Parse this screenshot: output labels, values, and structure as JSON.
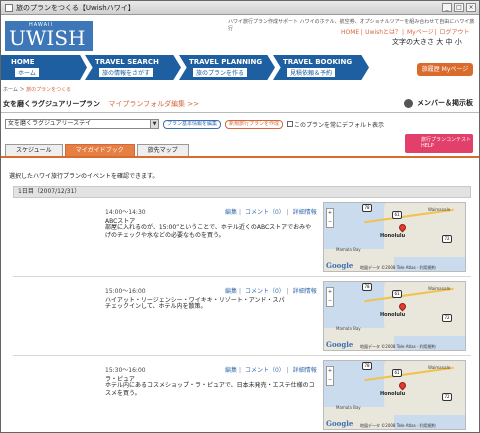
{
  "window": {
    "title": "旅のプランをつくる【Uwishハワイ】"
  },
  "header": {
    "logo_hawaii": "HAWAII",
    "logo_name": "UWISH",
    "tagline": "ハワイ旅行プラン作成サポート ハワイのホテル、航空券、オプショナルツアーを組み合わせて自由にハワイ旅行",
    "links": [
      "HOME",
      "Uwishとは？",
      "Myページ",
      "ログアウト"
    ],
    "font_size_label": "文字の大きさ",
    "font_sizes": [
      "大",
      "中",
      "小"
    ]
  },
  "nav": [
    {
      "en": "HOME",
      "jp": "ホーム"
    },
    {
      "en": "TRAVEL SEARCH",
      "jp": "旅の情報をさがす"
    },
    {
      "en": "TRAVEL PLANNING",
      "jp": "旅のプランを作る"
    },
    {
      "en": "TRAVEL BOOKING",
      "jp": "見積依頼＆予約"
    }
  ],
  "mypage_label": "旅履歴 Myページ",
  "breadcrumb": {
    "home": "ホーム",
    "sep": "＞",
    "current": "旅のプランをつくる"
  },
  "plan": {
    "title": "女を磨くラグジュアリープラン",
    "folder_link": "マイプランフォルダ編集 >>"
  },
  "members_label": "メンバー＆掲示板",
  "controls": {
    "selected_plan": "女を磨くラグジュアリーステイ",
    "edit_basic": "プラン基本情報を編集",
    "new_plan": "新規旅行プランを作成",
    "default_checkbox": "このプランを常にデフォルト表示"
  },
  "contest": {
    "line1": "旅行プランコンテスト",
    "line2": "HELP"
  },
  "tabs": [
    "スケジュール",
    "マイガイドブック",
    "旅先マップ"
  ],
  "intro": "選択したハワイ旅行プランのイベントを確認できます。",
  "day": {
    "label": "1日目（2007/12/31）"
  },
  "event_actions": {
    "edit": "編集",
    "comment": "コメント（0）",
    "detail": "詳細情報"
  },
  "events": [
    {
      "time": "14:00～14:30",
      "place": "ABCストア",
      "desc": "部屋に入れるのが、15:00”ということで、ホテル近くのABCストアでおみやげのチェックや水などの必要なものを買う。"
    },
    {
      "time": "15:00～16:00",
      "place": "ハイアット・リージェンシー・ワイキキ・リゾート・アンド・スパ",
      "desc": "チェックインして、ホテル内を散策。"
    },
    {
      "time": "15:30～16:00",
      "place": "ラ・ピュア",
      "desc": "ホテル内にあるコスメショップ・ラ・ピュアで、日本未発売・エステ仕様のコスメを買う。"
    }
  ],
  "map": {
    "city": "Honolulu",
    "area1": "Waimanalo",
    "area2": "Mamala Bay",
    "road": "61",
    "road2": "78",
    "road3": "72",
    "google": "Google",
    "copyright": "地図データ ©2008 Tele Atlas - 利用規約"
  }
}
